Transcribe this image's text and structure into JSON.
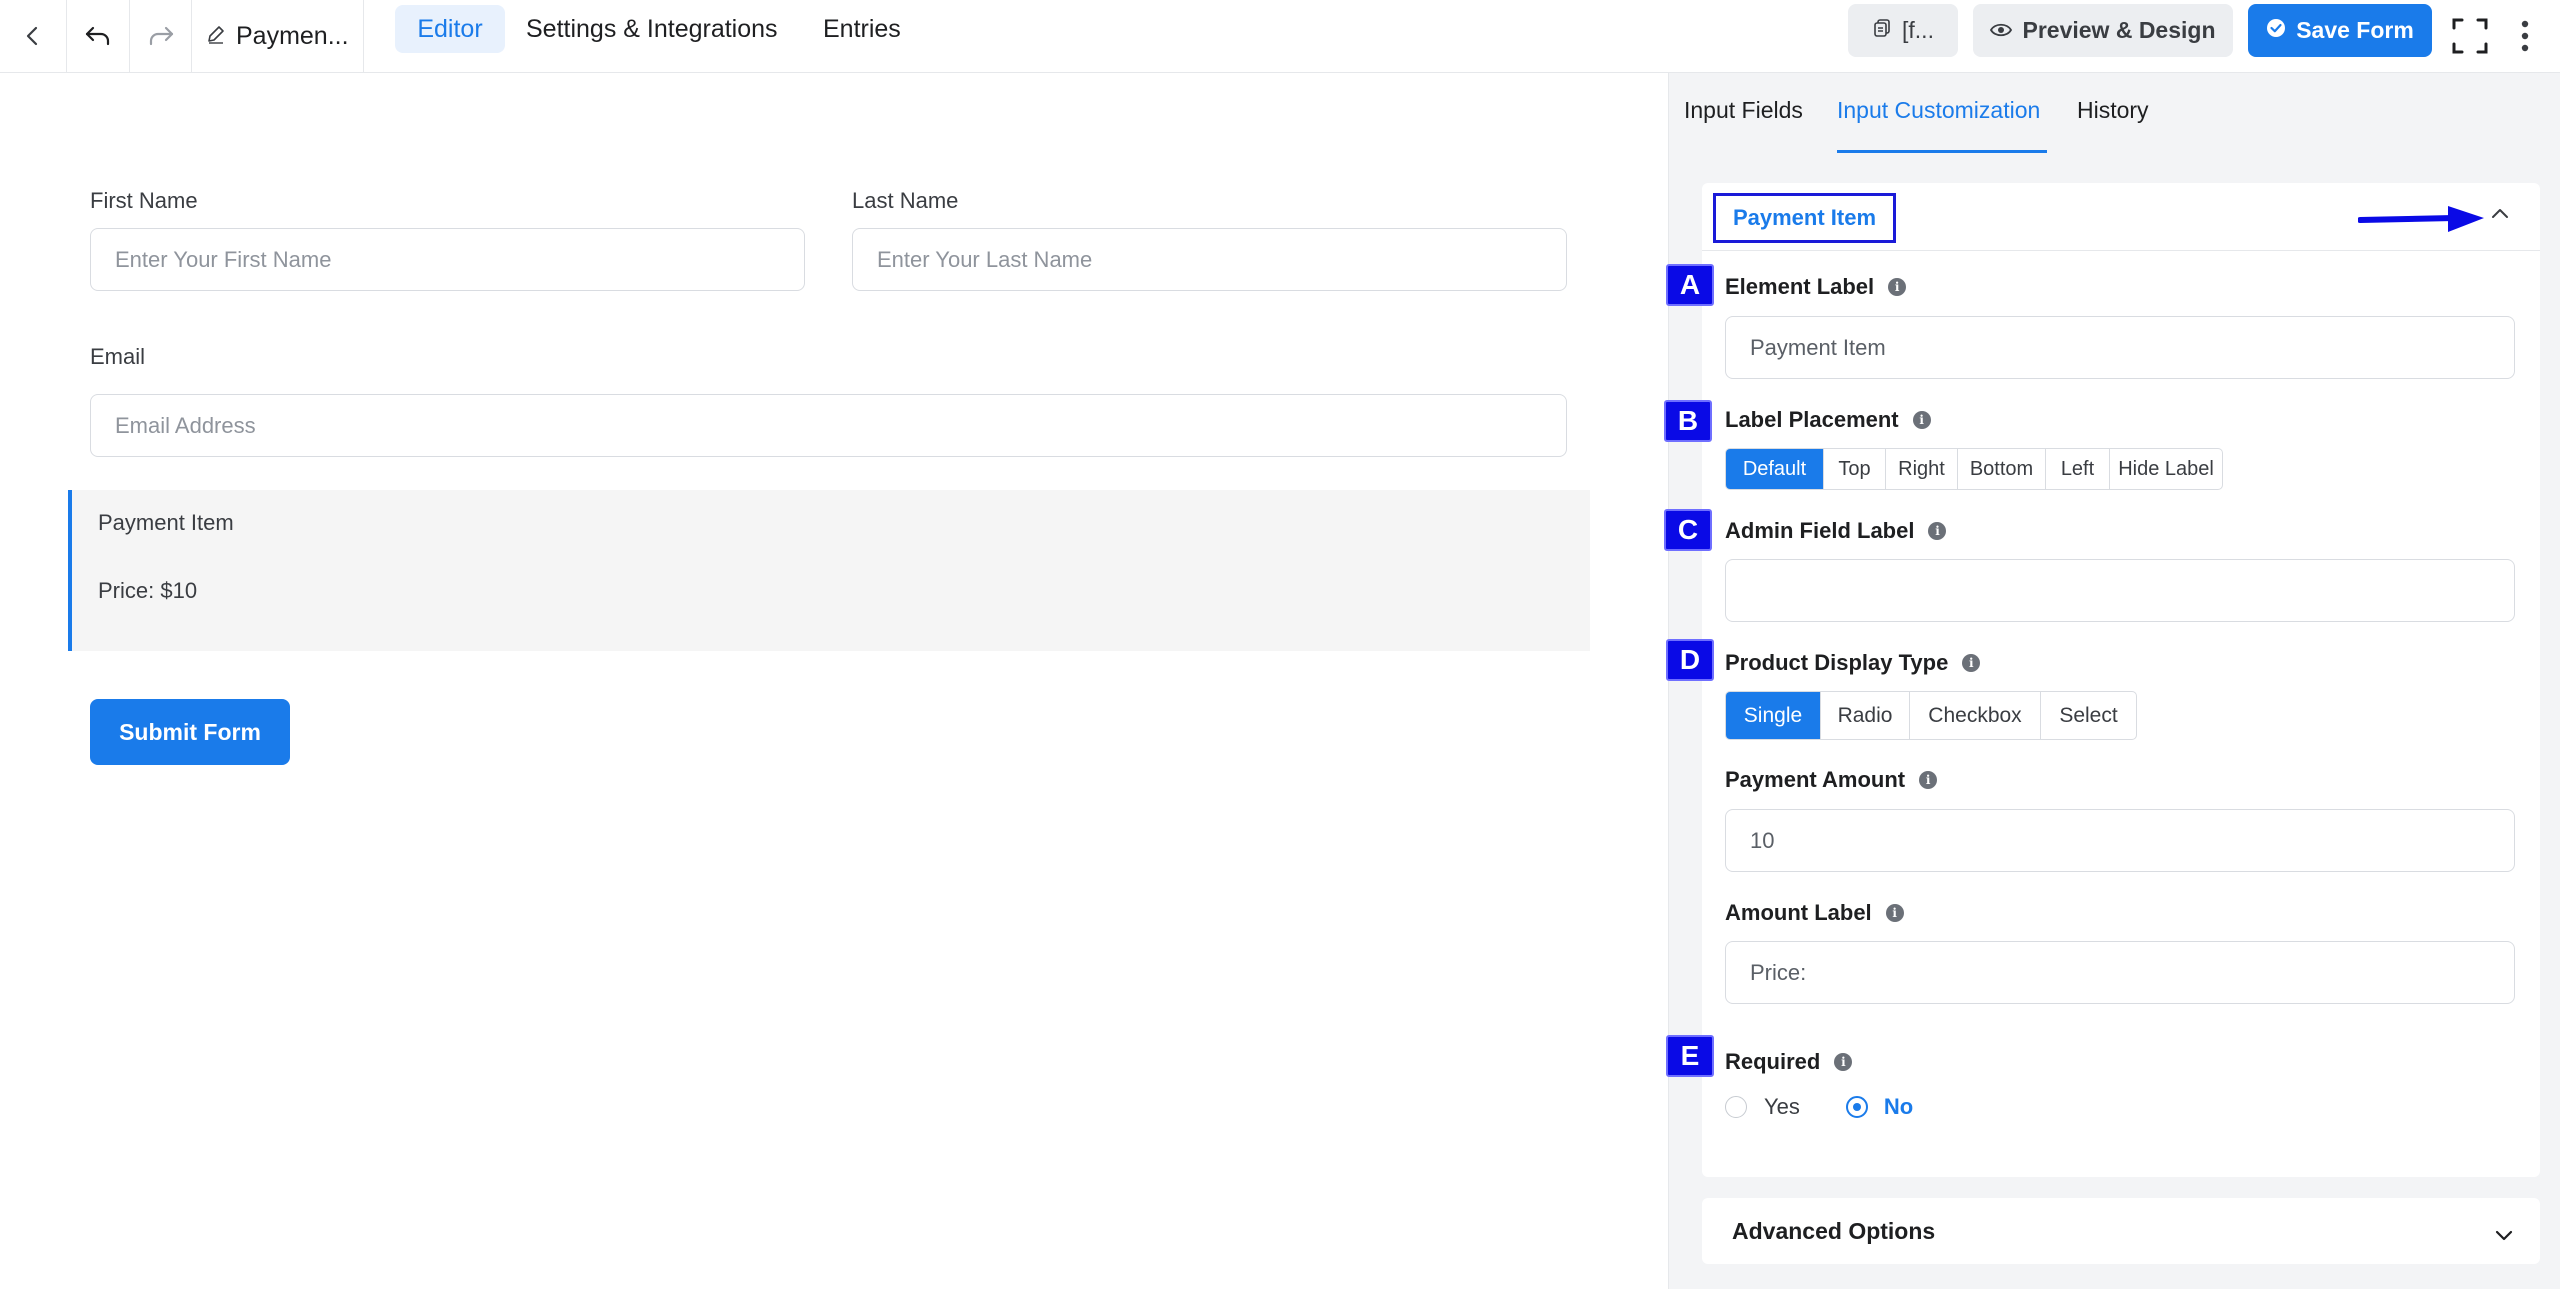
{
  "topbar": {
    "form_title": "Paymen...",
    "tabs": [
      {
        "label": "Editor",
        "active": true
      },
      {
        "label": "Settings & Integrations",
        "active": false
      },
      {
        "label": "Entries",
        "active": false
      }
    ],
    "shortcode_label": "[f...",
    "preview_label": "Preview & Design",
    "save_label": "Save Form"
  },
  "form": {
    "first_name": {
      "label": "First Name",
      "placeholder": "Enter Your First Name"
    },
    "last_name": {
      "label": "Last Name",
      "placeholder": "Enter Your Last Name"
    },
    "email": {
      "label": "Email",
      "placeholder": "Email Address"
    },
    "payment_item": {
      "title": "Payment Item",
      "price_text": "Price: $10"
    },
    "submit_label": "Submit Form"
  },
  "panel": {
    "tabs": [
      {
        "label": "Input Fields",
        "active": false
      },
      {
        "label": "Input Customization",
        "active": true
      },
      {
        "label": "History",
        "active": false
      }
    ],
    "section_title": "Payment Item",
    "element_label": {
      "badge": "A",
      "label": "Element Label",
      "value": "Payment Item"
    },
    "label_placement": {
      "badge": "B",
      "label": "Label Placement",
      "options": [
        "Default",
        "Top",
        "Right",
        "Bottom",
        "Left",
        "Hide Label"
      ],
      "selected": "Default"
    },
    "admin_field_label": {
      "badge": "C",
      "label": "Admin Field Label",
      "value": ""
    },
    "product_display_type": {
      "badge": "D",
      "label": "Product Display Type",
      "options": [
        "Single",
        "Radio",
        "Checkbox",
        "Select"
      ],
      "selected": "Single"
    },
    "payment_amount": {
      "label": "Payment Amount",
      "value": "10"
    },
    "amount_label": {
      "label": "Amount Label",
      "value": "Price:"
    },
    "required": {
      "badge": "E",
      "label": "Required",
      "options": [
        "Yes",
        "No"
      ],
      "selected": "No"
    },
    "advanced_label": "Advanced Options"
  },
  "colors": {
    "accent": "#1a7bea",
    "annotation": "#0a0ae6"
  },
  "icons": [
    "back-icon",
    "undo-icon",
    "redo-icon",
    "pencil-icon",
    "copy-icon",
    "eye-icon",
    "check-circle-icon",
    "fullscreen-icon",
    "more-vertical-icon",
    "info-icon",
    "chevron-up-icon",
    "chevron-down-icon",
    "annotation-arrow"
  ]
}
